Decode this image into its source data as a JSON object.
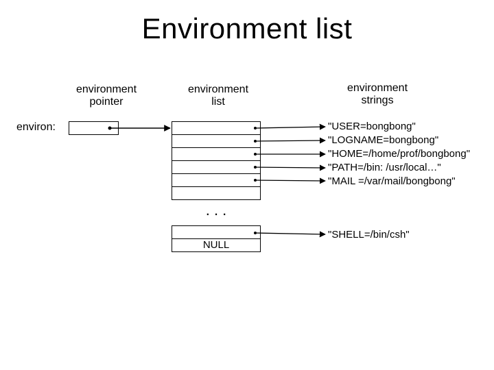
{
  "title": "Environment list",
  "headers": {
    "pointer": "environment\npointer",
    "list": "environment\nlist",
    "strings": "environment\nstrings"
  },
  "environ_label": "environ:",
  "dots": ". . .",
  "null_label": "NULL",
  "strings": {
    "s0": "\"USER=bongbong\"",
    "s1": "\"LOGNAME=bongbong\"",
    "s2": "\"HOME=/home/prof/bongbong\"",
    "s3": "\"PATH=/bin: /usr/local…\"",
    "s4": "\"MAIL =/var/mail/bongbong\"",
    "last": "\"SHELL=/bin/csh\""
  }
}
